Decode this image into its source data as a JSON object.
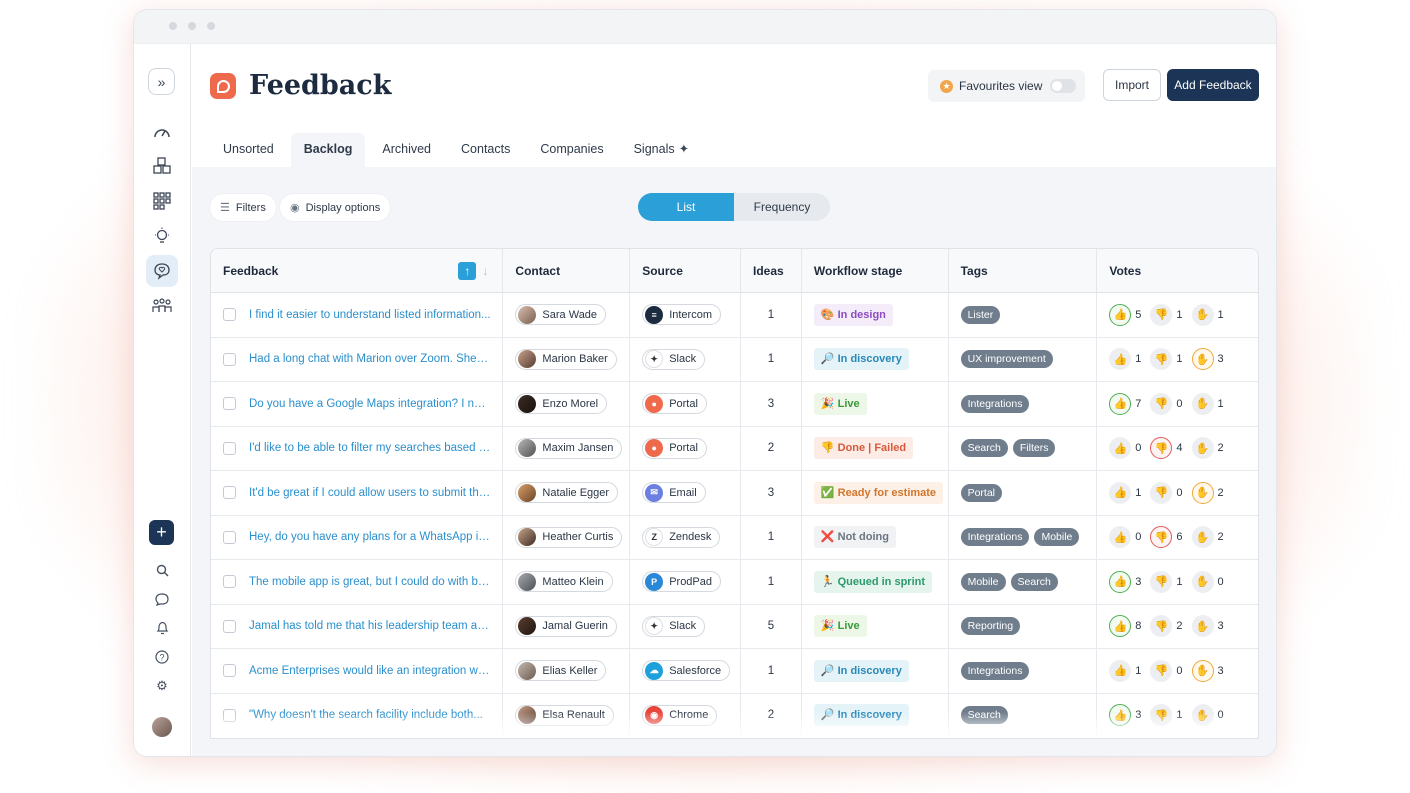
{
  "app": {
    "title": "Feedback",
    "favourites_label": "Favourites view",
    "import_label": "Import",
    "add_label": "Add Feedback"
  },
  "tabs": [
    {
      "label": "Unsorted"
    },
    {
      "label": "Backlog",
      "active": true
    },
    {
      "label": "Archived"
    },
    {
      "label": "Contacts"
    },
    {
      "label": "Companies"
    },
    {
      "label": "Signals",
      "icon": "sparkle-icon"
    }
  ],
  "toolbar": {
    "filters_label": "Filters",
    "display_label": "Display options",
    "view_list": "List",
    "view_frequency": "Frequency"
  },
  "columns": [
    "Feedback",
    "Contact",
    "Source",
    "Ideas",
    "Workflow stage",
    "Tags",
    "Votes"
  ],
  "rows": [
    {
      "feedback": "I find it easier to understand listed information...",
      "contact": "Sara Wade",
      "source": "Intercom",
      "ideas": "1",
      "stage": {
        "label": "In design",
        "icon": "🎨",
        "bg": "#f4ecf8",
        "fg": "#8d4cc4"
      },
      "tags": [
        "Lister"
      ],
      "votes": [
        {
          "n": "5",
          "s": "g"
        },
        {
          "n": "1",
          "s": ""
        },
        {
          "n": "1",
          "s": ""
        }
      ]
    },
    {
      "feedback": "Had a long chat with Marion over Zoom. She is...",
      "contact": "Marion Baker",
      "source": "Slack",
      "ideas": "1",
      "stage": {
        "label": "In discovery",
        "icon": "🔎",
        "bg": "#e3f3f8",
        "fg": "#2a88b8"
      },
      "tags": [
        "UX improvement"
      ],
      "votes": [
        {
          "n": "1",
          "s": ""
        },
        {
          "n": "1",
          "s": ""
        },
        {
          "n": "3",
          "s": "o"
        }
      ]
    },
    {
      "feedback": "Do you have a Google Maps integration? I need...",
      "contact": "Enzo Morel",
      "source": "Portal",
      "ideas": "3",
      "stage": {
        "label": "Live",
        "icon": "🎉",
        "bg": "#edf7e8",
        "fg": "#3a9a3a"
      },
      "tags": [
        "Integrations"
      ],
      "votes": [
        {
          "n": "7",
          "s": "g"
        },
        {
          "n": "0",
          "s": ""
        },
        {
          "n": "1",
          "s": ""
        }
      ]
    },
    {
      "feedback": "I'd like to be able to filter my searches based on...",
      "contact": "Maxim Jansen",
      "source": "Portal",
      "ideas": "2",
      "stage": {
        "label": "Done | Failed",
        "icon": "👎",
        "bg": "#fdece6",
        "fg": "#d65a3a"
      },
      "tags": [
        "Search",
        "Filters"
      ],
      "votes": [
        {
          "n": "0",
          "s": ""
        },
        {
          "n": "4",
          "s": "r"
        },
        {
          "n": "2",
          "s": ""
        }
      ]
    },
    {
      "feedback": "It'd be great if I could allow users to submit their...",
      "contact": "Natalie Egger",
      "source": "Email",
      "ideas": "3",
      "stage": {
        "label": "Ready for estimate",
        "icon": "✅",
        "bg": "#fdf0e6",
        "fg": "#d0762e"
      },
      "tags": [
        "Portal"
      ],
      "votes": [
        {
          "n": "1",
          "s": ""
        },
        {
          "n": "0",
          "s": ""
        },
        {
          "n": "2",
          "s": "o"
        }
      ]
    },
    {
      "feedback": "Hey, do you have any plans for a WhatsApp integration?",
      "contact": "Heather Curtis",
      "source": "Zendesk",
      "ideas": "1",
      "stage": {
        "label": "Not doing",
        "icon": "❌",
        "bg": "#f1f2f4",
        "fg": "#6b7480"
      },
      "tags": [
        "Integrations",
        "Mobile"
      ],
      "votes": [
        {
          "n": "0",
          "s": ""
        },
        {
          "n": "6",
          "s": "r"
        },
        {
          "n": "2",
          "s": ""
        }
      ]
    },
    {
      "feedback": "The mobile app is great, but I could do with being...",
      "contact": "Matteo Klein",
      "source": "ProdPad",
      "ideas": "1",
      "stage": {
        "label": "Queued in sprint",
        "icon": "🏃",
        "bg": "#e5f5ee",
        "fg": "#2b9a6b"
      },
      "tags": [
        "Mobile",
        "Search"
      ],
      "votes": [
        {
          "n": "3",
          "s": "g"
        },
        {
          "n": "1",
          "s": ""
        },
        {
          "n": "0",
          "s": ""
        }
      ]
    },
    {
      "feedback": "Jamal has told me that his leadership team are...",
      "contact": "Jamal Guerin",
      "source": "Slack",
      "ideas": "5",
      "stage": {
        "label": "Live",
        "icon": "🎉",
        "bg": "#edf7e8",
        "fg": "#3a9a3a"
      },
      "tags": [
        "Reporting"
      ],
      "votes": [
        {
          "n": "8",
          "s": "g"
        },
        {
          "n": "2",
          "s": ""
        },
        {
          "n": "3",
          "s": ""
        }
      ]
    },
    {
      "feedback": "Acme Enterprises would like an integration with...",
      "contact": "Elias Keller",
      "source": "Salesforce",
      "ideas": "1",
      "stage": {
        "label": "In discovery",
        "icon": "🔎",
        "bg": "#e3f3f8",
        "fg": "#2a88b8"
      },
      "tags": [
        "Integrations"
      ],
      "votes": [
        {
          "n": "1",
          "s": ""
        },
        {
          "n": "0",
          "s": ""
        },
        {
          "n": "3",
          "s": "o"
        }
      ]
    },
    {
      "feedback": "\"Why doesn't the search facility include both...",
      "contact": "Elsa Renault",
      "source": "Chrome",
      "ideas": "2",
      "stage": {
        "label": "In discovery",
        "icon": "🔎",
        "bg": "#e3f3f8",
        "fg": "#2a88b8"
      },
      "tags": [
        "Search"
      ],
      "votes": [
        {
          "n": "3",
          "s": "g"
        },
        {
          "n": "1",
          "s": ""
        },
        {
          "n": "0",
          "s": ""
        }
      ]
    }
  ],
  "source_icons": {
    "Intercom": {
      "bg": "#1c2b3f",
      "glyph": "≡"
    },
    "Slack": {
      "bg": "#ffffff",
      "glyph": "✦"
    },
    "Portal": {
      "bg": "#ef6a4c",
      "glyph": "●"
    },
    "Email": {
      "bg": "#6b7fe0",
      "glyph": "✉"
    },
    "Zendesk": {
      "bg": "#ffffff",
      "glyph": "Z"
    },
    "ProdPad": {
      "bg": "#2a88d8",
      "glyph": "P"
    },
    "Salesforce": {
      "bg": "#1ea0dc",
      "glyph": "☁"
    },
    "Chrome": {
      "bg": "#e8453c",
      "glyph": "◉"
    }
  },
  "vote_icons": [
    "👍",
    "👎",
    "✋"
  ]
}
